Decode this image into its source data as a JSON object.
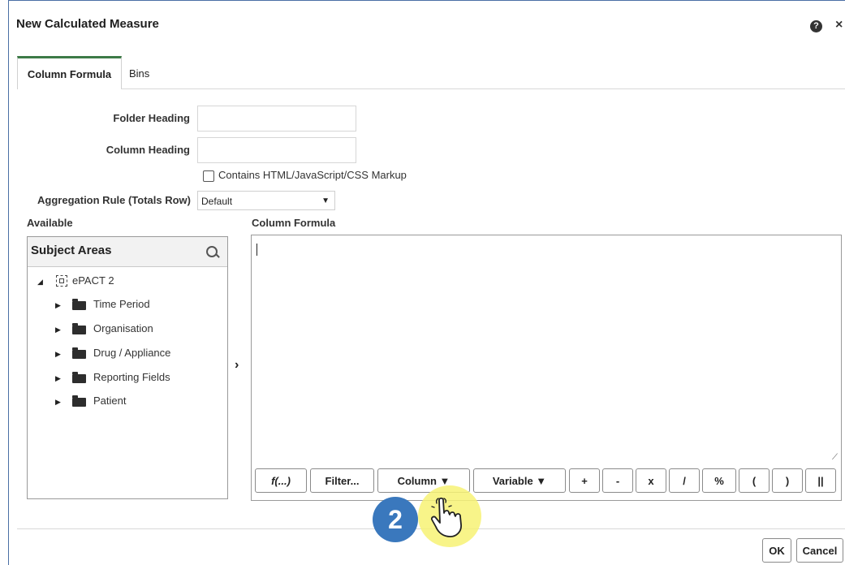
{
  "dialog": {
    "title": "New Calculated Measure",
    "help_icon_glyph": "?",
    "close_icon_glyph": "×"
  },
  "tabs": [
    {
      "label": "Column Formula",
      "active": true
    },
    {
      "label": "Bins",
      "active": false
    }
  ],
  "form": {
    "folder_heading_label": "Folder Heading",
    "folder_heading_value": "",
    "column_heading_label": "Column Heading",
    "column_heading_value": "",
    "markup_checkbox_label": "Contains HTML/JavaScript/CSS Markup",
    "markup_checked": false,
    "aggregation_label": "Aggregation Rule (Totals Row)",
    "aggregation_value": "Default"
  },
  "available": {
    "label": "Available",
    "panel_title": "Subject Areas",
    "root": "ePACT 2",
    "folders": [
      "Time Period",
      "Organisation",
      "Drug / Appliance",
      "Reporting Fields",
      "Patient"
    ]
  },
  "formula": {
    "label": "Column Formula",
    "value": "",
    "buttons": [
      "f(...)",
      "Filter...",
      "Column ▼",
      "Variable ▼",
      "+",
      "-",
      "x",
      "/",
      "%",
      "(",
      ")",
      "||"
    ]
  },
  "footer": {
    "ok_label": "OK",
    "cancel_label": "Cancel"
  },
  "overlay": {
    "step_number": "2"
  },
  "colors": {
    "active_tab_accent": "#3d7a47",
    "step_badge": "#3a78bd",
    "pointer_halo": "#f7f274"
  }
}
